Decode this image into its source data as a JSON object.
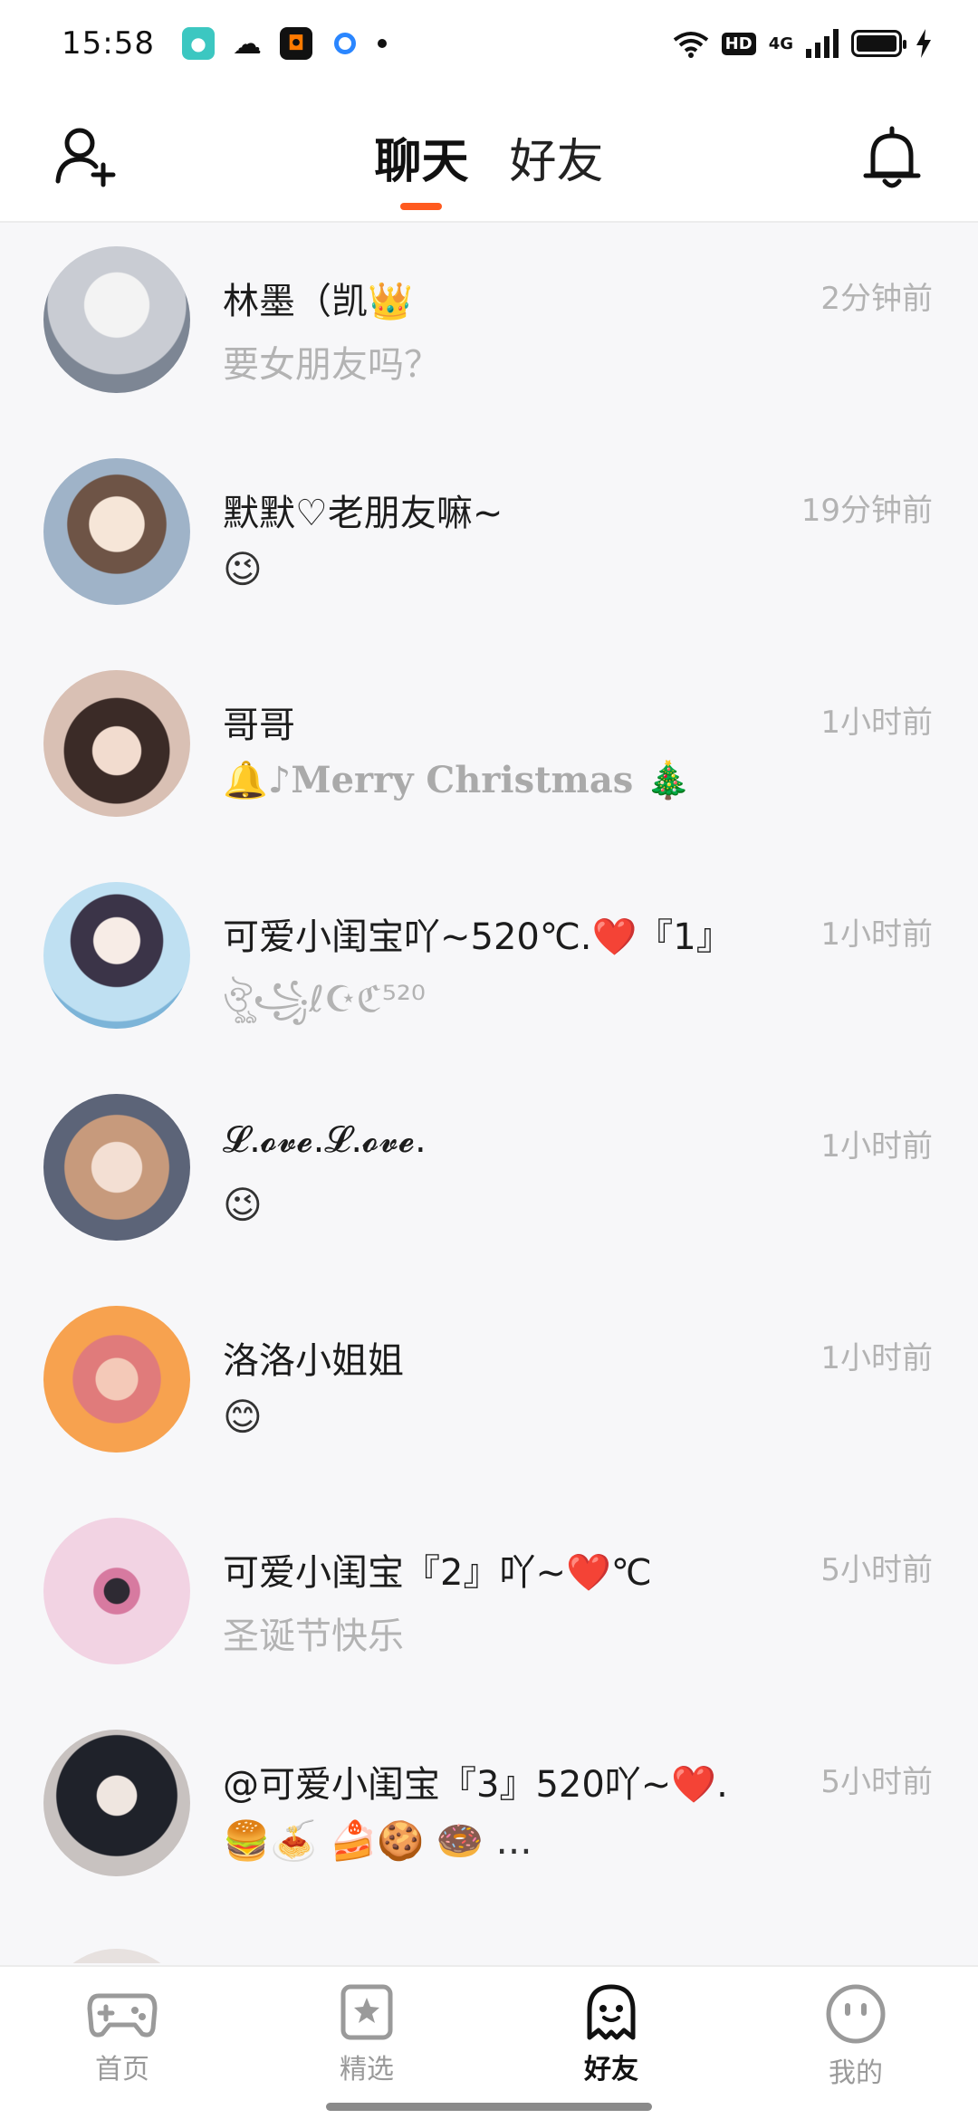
{
  "status_bar": {
    "time": "15:58",
    "network_label": "4G",
    "hd_label": "HD",
    "notification_icons": [
      "app-notification-icon",
      "wechat-icon",
      "app-square-icon",
      "browser-icon",
      "more-dot-icon"
    ]
  },
  "header": {
    "tabs": [
      {
        "label": "聊天",
        "active": true
      },
      {
        "label": "好友",
        "active": false
      }
    ],
    "accent_color": "#ff5a1f"
  },
  "conversations": [
    {
      "name": "林墨（凯👑",
      "time": "2分钟前",
      "preview": "要女朋友吗？",
      "preview_style": "text",
      "avatar_color": "#c9ccd3"
    },
    {
      "name": "默默♡老朋友嘛~",
      "time": "19分钟前",
      "preview": "😉",
      "preview_style": "emoji",
      "avatar_color": "#9fb3c8"
    },
    {
      "name": "哥哥",
      "time": "1小时前",
      "preview": "🔔♪Merry Christmas 🎄",
      "preview_style": "serif",
      "avatar_color": "#6b5a55"
    },
    {
      "name": "可爱小闺宝吖~520℃.❤️『1』",
      "time": "1小时前",
      "preview": "ঔৣ꧁ℓ☪ℭ⁵²⁰",
      "preview_style": "text",
      "avatar_color": "#9ec3e0"
    },
    {
      "name": "𝓛.𝓸𝓿𝓮.𝓛.𝓸𝓿𝓮.",
      "time": "1小时前",
      "preview": "😉",
      "preview_style": "emoji",
      "avatar_color": "#c59a86"
    },
    {
      "name": "洛洛小姐姐",
      "time": "1小时前",
      "preview": "😊",
      "preview_style": "emoji",
      "avatar_color": "#f0945a"
    },
    {
      "name": "可爱小闺宝『2』吖~❤️℃",
      "time": "5小时前",
      "preview": "圣诞节快乐",
      "preview_style": "text",
      "avatar_color": "#f0cfe0"
    },
    {
      "name": "@可爱小闺宝『3』520吖~❤️.",
      "time": "5小时前",
      "preview": "🍔🍝          🍰🍪    🍩   ...",
      "preview_style": "emoji",
      "avatar_color": "#3a3f4a"
    }
  ],
  "bottom_nav": [
    {
      "label": "首页",
      "icon": "gamepad-icon",
      "active": false
    },
    {
      "label": "精选",
      "icon": "star-bookmark-icon",
      "active": false
    },
    {
      "label": "好友",
      "icon": "ghost-icon",
      "active": true
    },
    {
      "label": "我的",
      "icon": "face-icon",
      "active": false
    }
  ]
}
